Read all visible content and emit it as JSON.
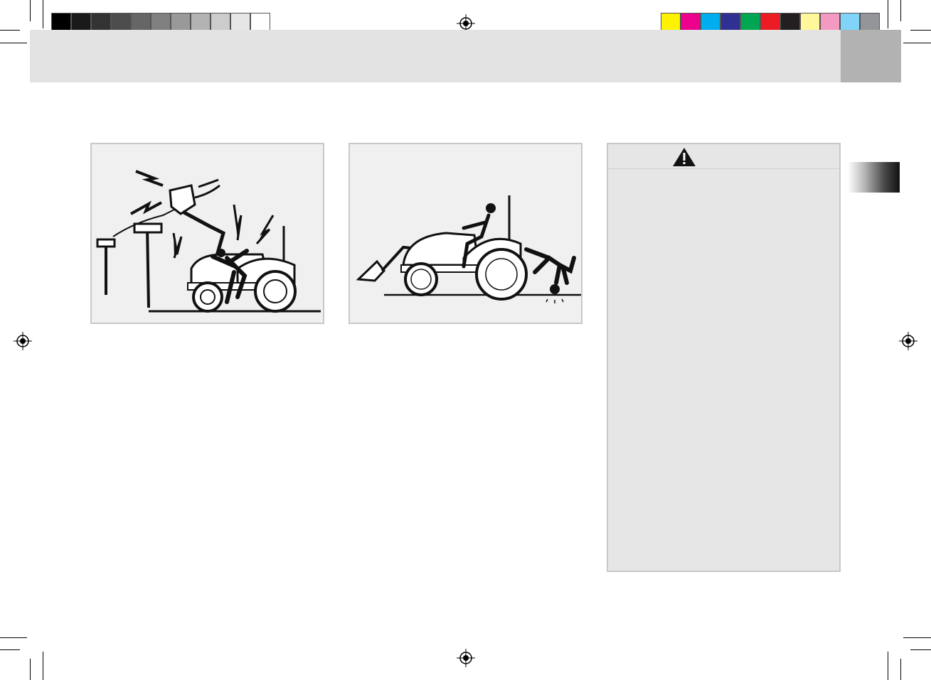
{
  "colors": {
    "header_band": "#e3e3e3",
    "header_tab": "#b2b2b2",
    "figure_bg": "#f0f0f0",
    "warning_bg": "#e6e6e6",
    "grayscale_bar": [
      "#000000",
      "#1a1a1a",
      "#333333",
      "#4d4d4d",
      "#666666",
      "#808080",
      "#999999",
      "#b3b3b3",
      "#cccccc",
      "#e6e6e6",
      "#ffffff"
    ],
    "color_bar": [
      "#fff200",
      "#ec008c",
      "#00aeef",
      "#2e3192",
      "#00a651",
      "#ed1c24",
      "#231f20",
      "#fff799",
      "#f49ac2",
      "#7fd4f7",
      "#939598"
    ]
  },
  "figures": [
    {
      "name": "power-line-electrocution",
      "icon": "tractor-loader-power-line-hazard"
    },
    {
      "name": "run-over-hazard",
      "icon": "tractor-run-over-person-hazard"
    }
  ],
  "warning": {
    "icon": "warning-triangle-icon",
    "symbol": "!"
  }
}
